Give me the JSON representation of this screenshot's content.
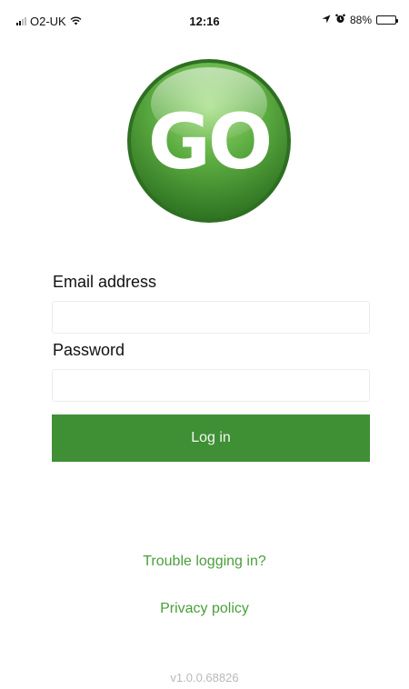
{
  "status_bar": {
    "carrier": "O2-UK",
    "time": "12:16",
    "battery": "88%",
    "battery_level": 0.88,
    "icons": [
      "signal-icon",
      "wifi-icon",
      "location-icon",
      "alarm-icon",
      "battery-icon"
    ]
  },
  "logo": {
    "text": "GO",
    "colors": {
      "light": "#8fd16e",
      "dark": "#2f7a22",
      "rim": "#2e6f22"
    }
  },
  "form": {
    "email_label": "Email address",
    "email_value": "",
    "password_label": "Password",
    "password_value": "",
    "login_label": "Log in"
  },
  "links": {
    "trouble": "Trouble logging in?",
    "privacy": "Privacy policy"
  },
  "version": "v1.0.0.68826",
  "colors": {
    "accent": "#3f8f34",
    "link": "#4a9e3b",
    "muted": "#b9b9b9"
  }
}
